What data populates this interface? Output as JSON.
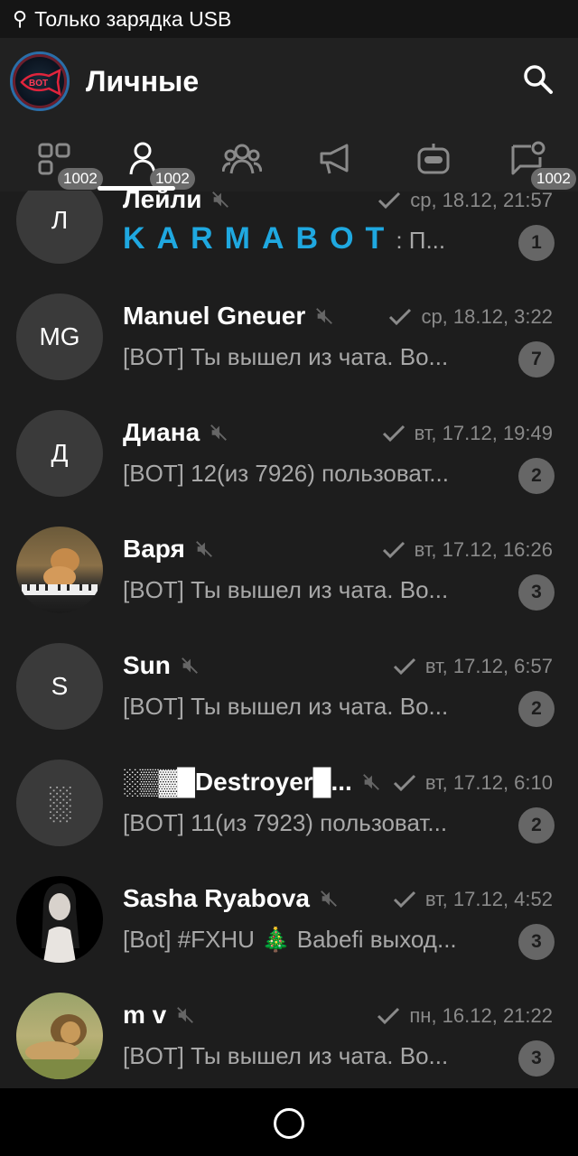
{
  "status_bar": {
    "text": "Только зарядка USB",
    "usb_icon": "⚲"
  },
  "header": {
    "title": "Личные"
  },
  "tabs": [
    {
      "name": "tab-all",
      "icon": "grid-icon",
      "badge": "1002"
    },
    {
      "name": "tab-personal",
      "icon": "person-icon",
      "badge": "1002"
    },
    {
      "name": "tab-groups",
      "icon": "group-icon",
      "badge": ""
    },
    {
      "name": "tab-channels",
      "icon": "megaphone-icon",
      "badge": ""
    },
    {
      "name": "tab-bots",
      "icon": "bot-icon",
      "badge": ""
    },
    {
      "name": "tab-unread",
      "icon": "chat-icon",
      "badge": "1002"
    }
  ],
  "chats": [
    {
      "initials": "Л",
      "name": "Лейли",
      "date": "ср, 18.12, 21:57",
      "preview_brand": "KARMABOT",
      "preview": ": П...",
      "unread": "1"
    },
    {
      "initials": "MG",
      "name": "Manuel Gneuer",
      "date": "ср, 18.12, 3:22",
      "preview": "[BOT] Ты вышел из чата. Во...",
      "unread": "7"
    },
    {
      "initials": "Д",
      "name": "Диана",
      "date": "вт, 17.12, 19:49",
      "preview": "[BOT] 12(из 7926) пользоват...",
      "unread": "2"
    },
    {
      "initials": "",
      "name": "Варя",
      "date": "вт, 17.12, 16:26",
      "preview": "[BOT] Ты вышел из чата. Во...",
      "unread": "3"
    },
    {
      "initials": "S",
      "name": "Sun",
      "date": "вт, 17.12, 6:57",
      "preview": "[BOT] Ты вышел из чата. Во...",
      "unread": "2"
    },
    {
      "initials": "░",
      "name": "░▒▓█Destroyer█...",
      "date": "вт, 17.12, 6:10",
      "preview": "[BOT] 11(из 7923) пользоват...",
      "unread": "2"
    },
    {
      "initials": "",
      "name": "Sasha Ryabova",
      "date": "вт, 17.12, 4:52",
      "preview": "[Bot] #FXHU 🎄 Babefi выход...",
      "unread": "3"
    },
    {
      "initials": "",
      "name": "m v",
      "date": "пн, 16.12, 21:22",
      "preview": "[BOT] Ты вышел из чата. Во...",
      "unread": "3"
    }
  ]
}
